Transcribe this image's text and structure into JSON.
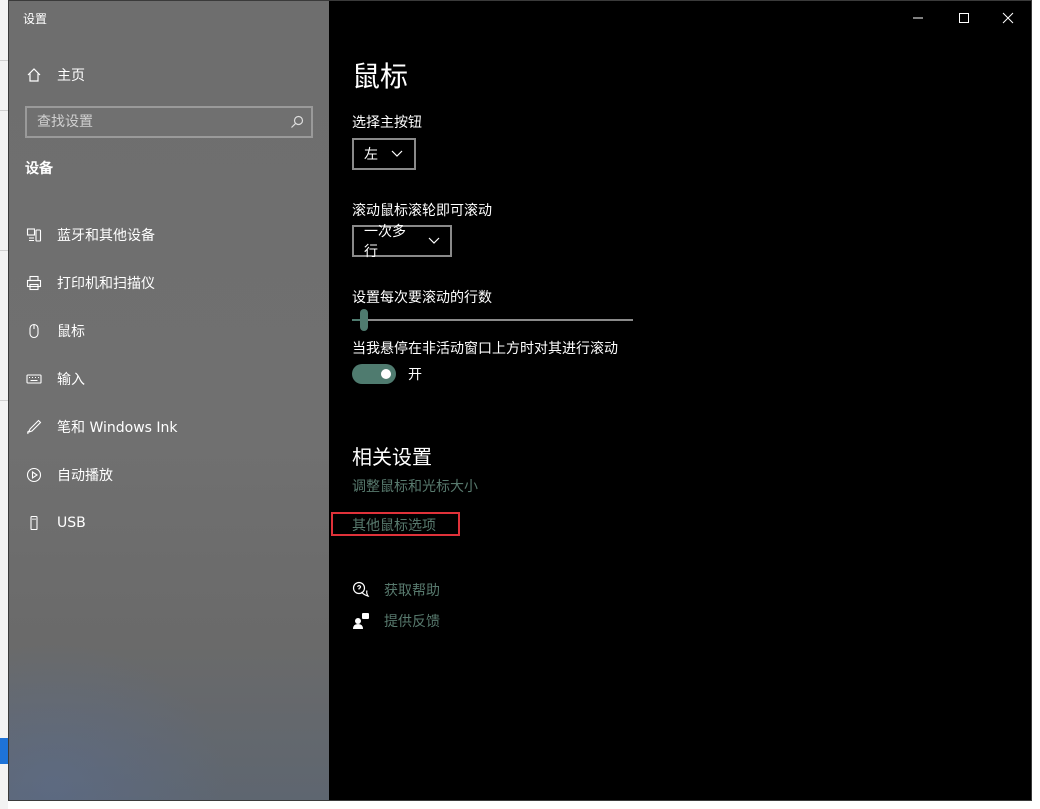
{
  "window": {
    "title": "设置"
  },
  "sidebar": {
    "home_label": "主页",
    "search_placeholder": "查找设置",
    "section_title": "设备",
    "items": [
      {
        "label": "蓝牙和其他设备",
        "icon": "bluetooth-devices-icon"
      },
      {
        "label": "打印机和扫描仪",
        "icon": "printer-icon"
      },
      {
        "label": "鼠标",
        "icon": "mouse-icon"
      },
      {
        "label": "输入",
        "icon": "keyboard-icon"
      },
      {
        "label": "笔和 Windows Ink",
        "icon": "pen-icon"
      },
      {
        "label": "自动播放",
        "icon": "autoplay-icon"
      },
      {
        "label": "USB",
        "icon": "usb-icon"
      }
    ]
  },
  "main": {
    "title": "鼠标",
    "primary_button": {
      "label": "选择主按钮",
      "value": "左"
    },
    "scroll_mode": {
      "label": "滚动鼠标滚轮即可滚动",
      "value": "一次多行"
    },
    "scroll_lines": {
      "label": "设置每次要滚动的行数",
      "value_fraction": 0.03
    },
    "inactive_scroll": {
      "label": "当我悬停在非活动窗口上方时对其进行滚动",
      "state_label": "开",
      "on": true
    },
    "related": {
      "title": "相关设置",
      "links": [
        "调整鼠标和光标大小",
        "其他鼠标选项"
      ]
    },
    "help": {
      "get_help": "获取帮助",
      "feedback": "提供反馈"
    }
  },
  "colors": {
    "accent": "#4f7b6f",
    "link": "#587a6e",
    "highlight": "#e0323a"
  }
}
